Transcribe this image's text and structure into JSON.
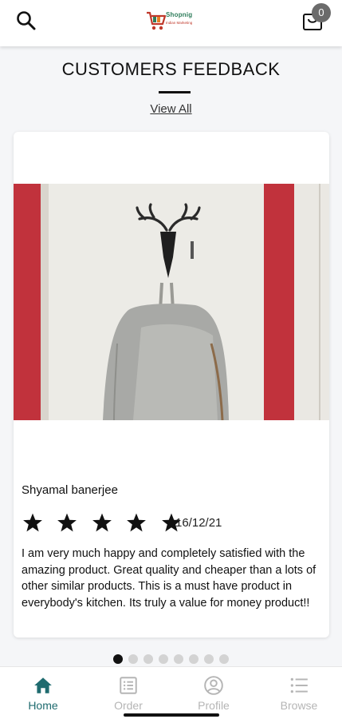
{
  "header": {
    "search_icon": "search-icon",
    "logo_text": "Shopnig",
    "logo_tagline": "Indian Marketing",
    "cart_icon": "shopping-bag-icon",
    "cart_count": "0"
  },
  "section": {
    "title": "CUSTOMERS FEEDBACK",
    "view_all": "View All"
  },
  "review": {
    "reviewer": "Shyamal banerjee",
    "rating": 5,
    "rating_max": 5,
    "date": "16/12/21",
    "text": "I am very much happy and completely satisfied with the amazing product. Great quality and cheaper than a lots of other similar products. This is a must have product in everybody's kitchen. Its truly a value for money product!!"
  },
  "carousel": {
    "total": 8,
    "active_index": 0
  },
  "nav": {
    "items": [
      {
        "label": "Home",
        "icon": "home-icon",
        "active": true
      },
      {
        "label": "Order",
        "icon": "order-list-icon",
        "active": false
      },
      {
        "label": "Profile",
        "icon": "profile-icon",
        "active": false
      },
      {
        "label": "Browse",
        "icon": "browse-list-icon",
        "active": false
      }
    ]
  },
  "colors": {
    "accent": "#1f6b6f",
    "background": "#f5f6f8",
    "inactive": "#b5b5b5"
  }
}
